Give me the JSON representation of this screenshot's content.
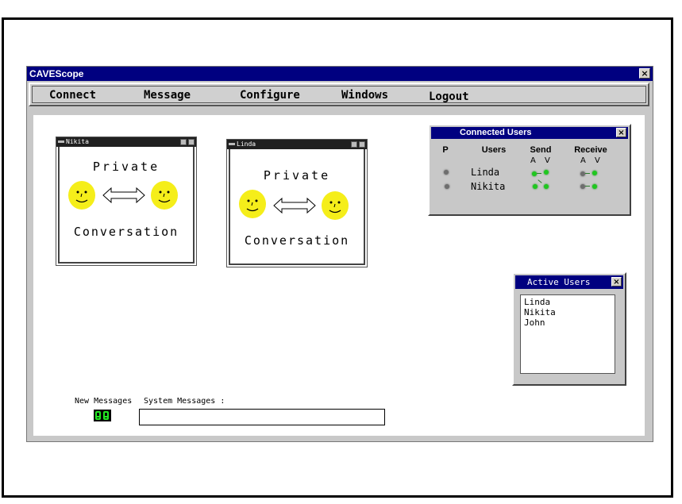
{
  "window": {
    "title": "CAVEScope",
    "close": "×"
  },
  "menu": [
    "Connect",
    "Message",
    "Configure",
    "Windows",
    "Logout"
  ],
  "conversations": [
    {
      "title": "Nikita",
      "line1": "Private",
      "line2": "Conversation"
    },
    {
      "title": "Linda",
      "line1": "Private",
      "line2": "Conversation"
    }
  ],
  "connected_users": {
    "title": "Connected Users",
    "close": "×",
    "headers": {
      "p": "P",
      "users": "Users",
      "send": "Send",
      "receive": "Receive"
    },
    "send_av": "A V",
    "receive_av": "A V",
    "rows": [
      {
        "name": "Linda"
      },
      {
        "name": "Nikita"
      }
    ]
  },
  "active_users": {
    "title": "Active Users",
    "close": "×",
    "items": [
      "Linda",
      "Nikita",
      "John"
    ]
  },
  "messages": {
    "new_label": "New Messages",
    "system_label": "System Messages :",
    "system_value": ""
  },
  "colors": {
    "titlebar": "#000080",
    "face": "#f5ee1a",
    "indicator_on": "#1fc81f",
    "indicator_off": "#6e6e6e"
  }
}
